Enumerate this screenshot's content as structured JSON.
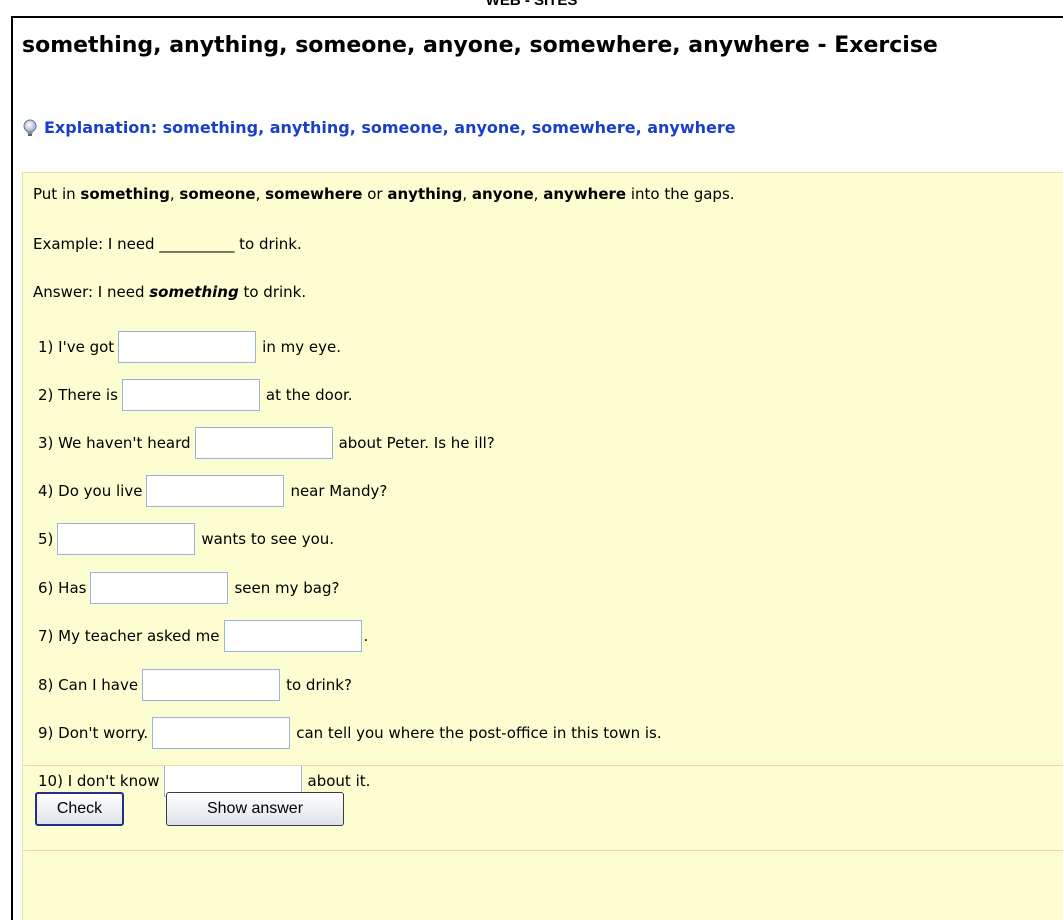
{
  "page": {
    "top_caption": "WEB - SITES",
    "title": "something, anything, someone, anyone, somewhere, anywhere - Exercise",
    "explanation_link": "Explanation: something, anything, someone, anyone, somewhere, anywhere"
  },
  "instructions": {
    "prefix": "Put in ",
    "w1": "something",
    "c1": ", ",
    "w2": "someone",
    "c2": ", ",
    "w3": "somewhere",
    "or": " or ",
    "w4": "anything",
    "c3": ", ",
    "w5": "anyone",
    "c4": ", ",
    "w6": "anywhere",
    "suffix": " into the gaps."
  },
  "example": {
    "before": "Example: I need ",
    "blank": "__________",
    "after": " to drink."
  },
  "answer": {
    "before": "Answer: I need ",
    "word": "something",
    "after": " to drink."
  },
  "questions": [
    {
      "before": "1) I've got",
      "after": "in my eye.",
      "value": ""
    },
    {
      "before": "2) There is",
      "after": "at the door.",
      "value": ""
    },
    {
      "before": "3) We haven't heard",
      "after": "about Peter. Is he ill?",
      "value": ""
    },
    {
      "before": "4) Do you live",
      "after": "near Mandy?",
      "value": ""
    },
    {
      "before": "5)",
      "after": "wants to see you.",
      "value": ""
    },
    {
      "before": "6) Has",
      "after": "seen my bag?",
      "value": ""
    },
    {
      "before": "7) My teacher asked me",
      "after": ".",
      "value": ""
    },
    {
      "before": "8) Can I have",
      "after": "to drink?",
      "value": ""
    },
    {
      "before": "9) Don't worry.",
      "after": "can tell you where the post-office in this town is.",
      "value": ""
    },
    {
      "before": "10) I don't know",
      "after": "about it.",
      "value": ""
    }
  ],
  "buttons": {
    "check": "Check",
    "show_answer": "Show answer"
  },
  "icons": {
    "explanation": "lightbulb-icon"
  },
  "colors": {
    "link": "#1a3fc8",
    "panel_bg": "#fdfdd2",
    "input_border": "#9bb3d9"
  }
}
